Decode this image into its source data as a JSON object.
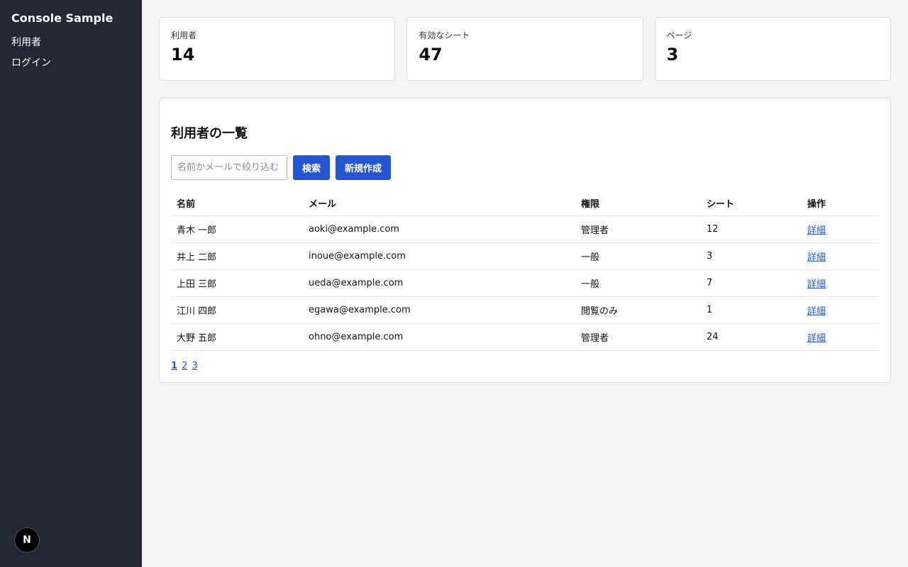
{
  "sidebar": {
    "brand": "Console Sample",
    "items": [
      {
        "label": "利用者"
      },
      {
        "label": "ログイン"
      }
    ],
    "badge": "N"
  },
  "stats": [
    {
      "label": "利用者",
      "value": "14"
    },
    {
      "label": "有効なシート",
      "value": "47"
    },
    {
      "label": "ページ",
      "value": "3"
    }
  ],
  "panel": {
    "title": "利用者の一覧",
    "search_placeholder": "名前かメールで絞り込む",
    "search_label": "検索",
    "create_label": "新規作成",
    "headers": {
      "name": "名前",
      "email": "メール",
      "role": "権限",
      "seats": "シート",
      "action": "操作"
    },
    "rows": [
      {
        "name": "青木 一郎",
        "email": "aoki@example.com",
        "role": "管理者",
        "seats": "12",
        "action": "詳細"
      },
      {
        "name": "井上 二郎",
        "email": "inoue@example.com",
        "role": "一般",
        "seats": "3",
        "action": "詳細"
      },
      {
        "name": "上田 三郎",
        "email": "ueda@example.com",
        "role": "一般",
        "seats": "7",
        "action": "詳細"
      },
      {
        "name": "江川 四郎",
        "email": "egawa@example.com",
        "role": "閲覧のみ",
        "seats": "1",
        "action": "詳細"
      },
      {
        "name": "大野 五郎",
        "email": "ohno@example.com",
        "role": "管理者",
        "seats": "24",
        "action": "詳細"
      }
    ],
    "pages": [
      "1",
      "2",
      "3"
    ]
  },
  "colors": {
    "sidebar": "#222731",
    "accent": "#2456d3",
    "background": "#f4f4f4"
  }
}
